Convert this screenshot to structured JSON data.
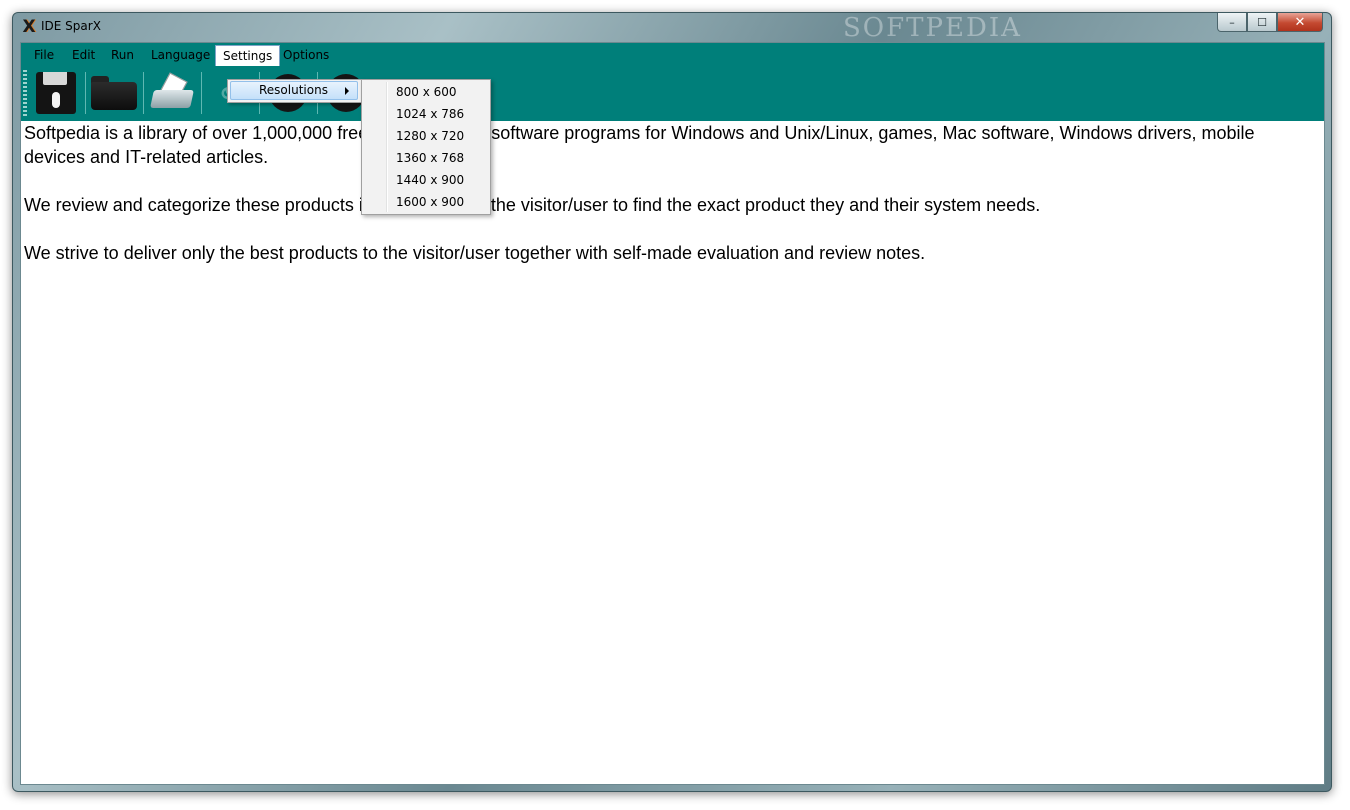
{
  "window": {
    "title": "IDE SparX",
    "watermark": "SOFTPEDIA",
    "controls": {
      "minimize": "–",
      "maximize": "☐",
      "close": "✕"
    }
  },
  "menubar": {
    "items": [
      "File",
      "Edit",
      "Run",
      "Language",
      "Settings",
      "Options"
    ],
    "open": "Settings"
  },
  "toolbar": {
    "buttons": [
      "save-icon",
      "open-folder-icon",
      "print-icon",
      "link-icon",
      "info-icon",
      "help-icon"
    ],
    "info_glyph": "i",
    "help_glyph": "?"
  },
  "settings_menu": {
    "resolutions_label": "Resolutions"
  },
  "resolutions_submenu": {
    "options": [
      "800 x 600",
      "1024 x 786",
      "1280 x 720",
      "1360 x 768",
      "1440 x 900",
      "1600 x 900"
    ]
  },
  "editor": {
    "paragraphs": [
      "Softpedia is a library of over 1,000,000 free and free-to-try software programs for Windows and Unix/Linux, games, Mac software, Windows drivers, mobile devices and IT-related articles.",
      "We review and categorize these products in order to allow the visitor/user to find the exact product they and their system needs.",
      "We strive to deliver only the best products to the visitor/user together with self-made evaluation and review notes."
    ]
  },
  "colors": {
    "menubar_bg": "#007f7a",
    "menu_highlight": "#c4e0fa"
  }
}
